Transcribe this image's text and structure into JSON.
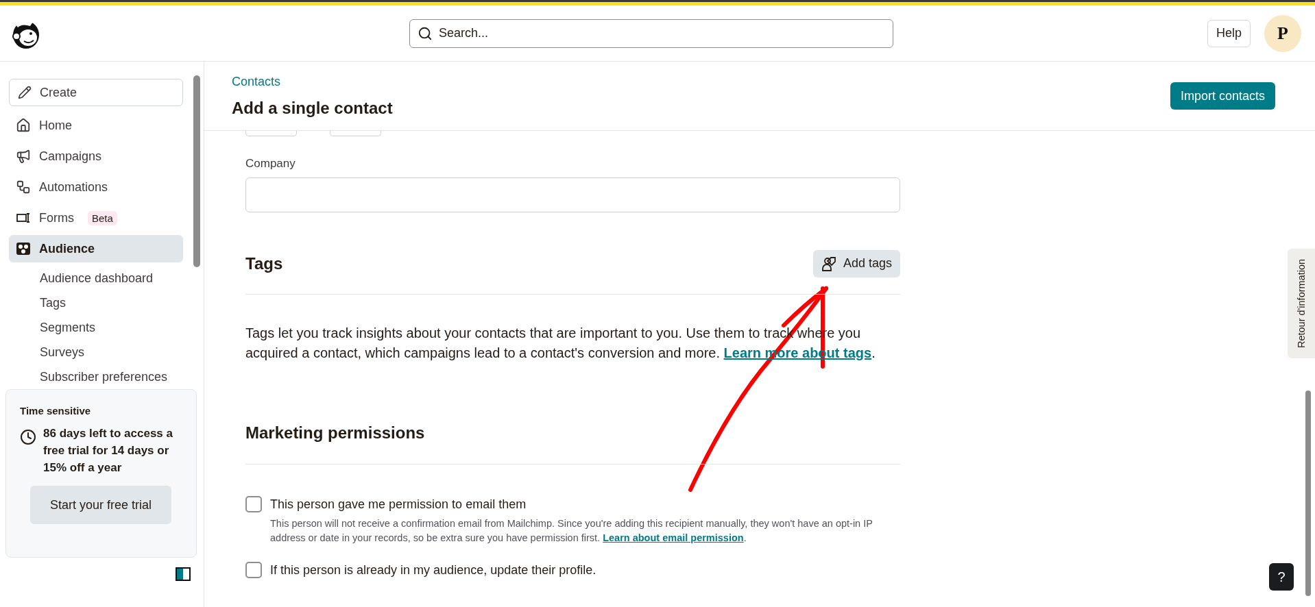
{
  "header": {
    "search": {
      "placeholder": "Search..."
    },
    "help": "Help",
    "avatar": "P"
  },
  "sidebar": {
    "create": "Create",
    "items": [
      {
        "kind": "home",
        "label": "Home",
        "selected": false
      },
      {
        "kind": "campaigns",
        "label": "Campaigns",
        "selected": false
      },
      {
        "kind": "automations",
        "label": "Automations",
        "selected": false
      },
      {
        "kind": "forms",
        "label": "Forms",
        "badge": "Beta",
        "selected": false
      },
      {
        "kind": "audience",
        "label": "Audience",
        "selected": true,
        "children": [
          {
            "label": "Audience dashboard",
            "selected": false
          },
          {
            "label": "Tags",
            "selected": false
          },
          {
            "label": "Segments",
            "selected": false
          },
          {
            "label": "Surveys",
            "selected": false
          },
          {
            "label": "Subscriber preferences",
            "selected": false
          }
        ]
      }
    ],
    "trial": {
      "eyebrow": "Time sensitive",
      "message": "86 days left to access a free trial for 14 days or 15% off a year",
      "button": "Start your free trial"
    }
  },
  "page": {
    "breadcrumb": "Contacts",
    "title": "Add a single contact",
    "import_button": "Import contacts"
  },
  "form": {
    "company": {
      "label": "Company"
    },
    "tags": {
      "heading": "Tags",
      "button": "Add tags",
      "text": "Tags let you track insights about your contacts that are important to you. Use them to track where you acquired a contact, which campaigns lead to a contact's conversion and more. ",
      "link": "Learn more about tags",
      "after": "."
    },
    "permissions": {
      "heading": "Marketing permissions",
      "options": [
        {
          "label": "This person gave me permission to email them",
          "checked": false,
          "note": "This person will not receive a confirmation email from Mailchimp. Since you're adding this recipient manually, they won't have an opt-in IP address or date in your records, so be extra sure you have permission first. ",
          "note_link": "Learn about email permission",
          "note_after": "."
        },
        {
          "label": "If this person is already in my audience, update their profile.",
          "checked": false
        }
      ]
    }
  },
  "feedback_tab": "Retour d'information",
  "help_fab": "?"
}
